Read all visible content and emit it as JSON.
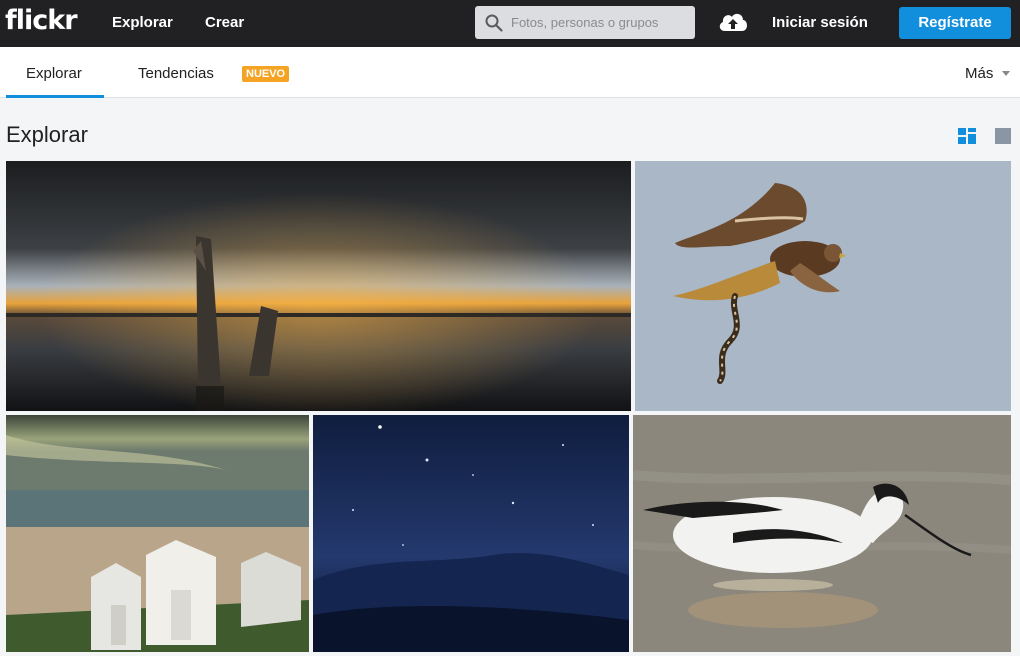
{
  "header": {
    "logo": "flickr",
    "nav": [
      "Explorar",
      "Crear"
    ],
    "search_placeholder": "Fotos, personas o grupos",
    "login": "Iniciar sesión",
    "signup": "Regístrate"
  },
  "subnav": {
    "tabs": [
      "Explorar",
      "Tendencias"
    ],
    "badge": "NUEVO",
    "more": "Más"
  },
  "main": {
    "title": "Explorar"
  },
  "colors": {
    "accent": "#128fdc",
    "badge": "#f4a322",
    "topbar": "#212124"
  },
  "photos": [
    {
      "name": "sunset-lake-posts"
    },
    {
      "name": "hawk-with-snake"
    },
    {
      "name": "beach-huts"
    },
    {
      "name": "night-sky-stars"
    },
    {
      "name": "avocet-bird"
    }
  ]
}
